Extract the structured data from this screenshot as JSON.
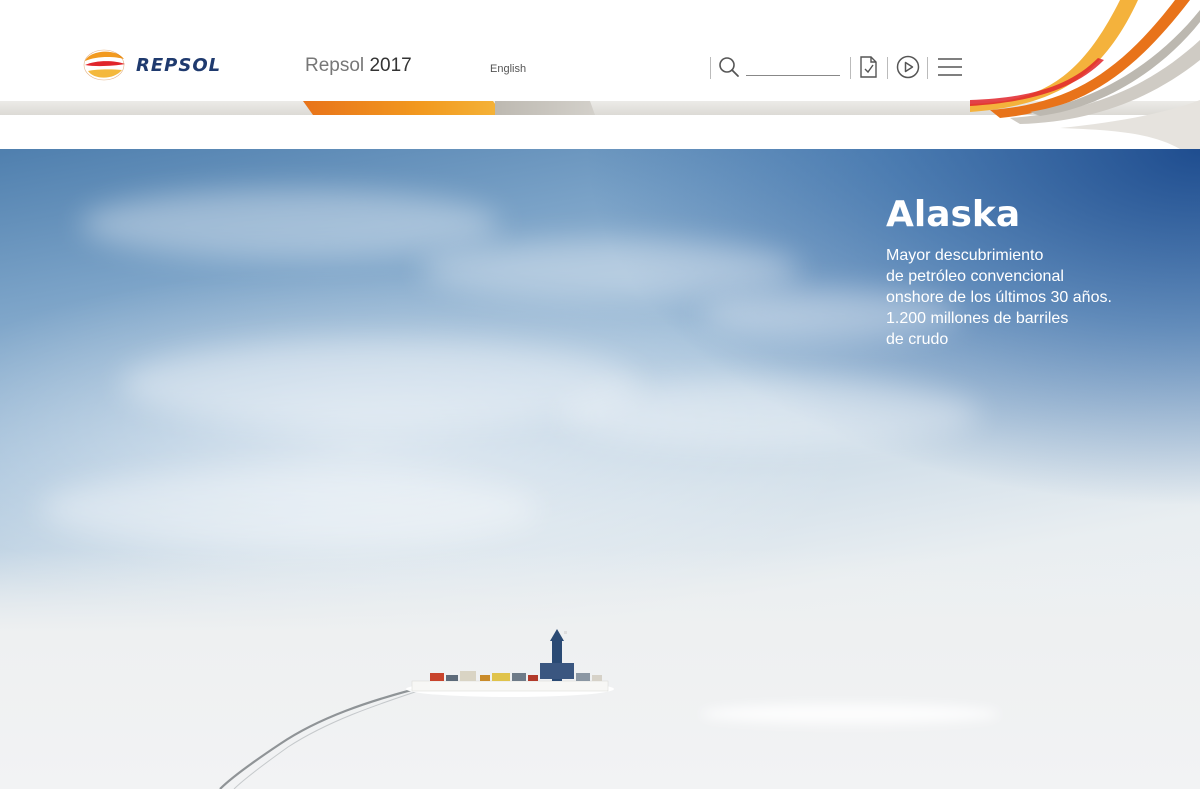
{
  "header": {
    "logo_text": "REPSOL",
    "site_title": "Repsol",
    "site_year": "2017",
    "language_link": "English",
    "search": {
      "value": "",
      "placeholder": ""
    },
    "icons": [
      "search-icon",
      "document-icon",
      "play-icon",
      "menu-icon"
    ]
  },
  "hero": {
    "title": "Alaska",
    "description_lines": [
      "Mayor descubrimiento",
      "de petróleo convencional",
      "onshore de los últimos 30 años.",
      "1.200 millones de barriles",
      "de crudo"
    ]
  },
  "colors": {
    "brand_orange": "#f29a1f",
    "brand_red": "#e0252b",
    "brand_navy": "#1f3a6e",
    "sky_blue": "#1c4a8c"
  }
}
